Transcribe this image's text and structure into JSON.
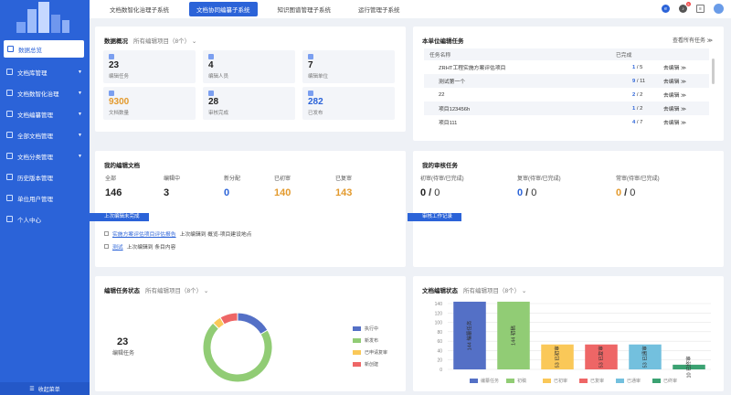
{
  "sidebar": {
    "collapse_label": "收起菜单",
    "items": [
      {
        "label": "数据总览",
        "active": true
      },
      {
        "label": "文档库管理",
        "arrow": true
      },
      {
        "label": "文档数智化治理",
        "arrow": true
      },
      {
        "label": "文档编纂管理",
        "arrow": true
      },
      {
        "label": "全部文档管理",
        "arrow": true
      },
      {
        "label": "文档分类管理",
        "arrow": true
      },
      {
        "label": "历史版本管理"
      },
      {
        "label": "单位用户管理"
      },
      {
        "label": "个人中心"
      }
    ]
  },
  "topbar": {
    "tabs": [
      "文档数智化治理子系统",
      "文档协同编纂子系统",
      "知识图谱管理子系统",
      "运行管理子系统"
    ],
    "active_tab": 1,
    "notification_count": "5"
  },
  "overview": {
    "title": "数据概况",
    "filter": "所有编辑项目（8个）",
    "stats": [
      {
        "value": "23",
        "label": "编辑任务",
        "color": "#222"
      },
      {
        "value": "4",
        "label": "编辑人员",
        "color": "#222"
      },
      {
        "value": "7",
        "label": "编辑单位",
        "color": "#222"
      },
      {
        "value": "9300",
        "label": "文档数量",
        "color": "#e39a2d"
      },
      {
        "value": "28",
        "label": "审核完成",
        "color": "#222"
      },
      {
        "value": "282",
        "label": "已发布",
        "color": "#2b63d8"
      }
    ]
  },
  "tasks": {
    "title": "本单位编辑任务",
    "view_all": "查看所有任务 ≫",
    "headers": [
      "任务名称",
      "已完成",
      ""
    ],
    "rows": [
      {
        "name": "ZRHT工程实施方案评估项目",
        "done": "1",
        "total": "5",
        "action": "去编辑 ≫"
      },
      {
        "name": "测试第一个",
        "done": "9",
        "total": "11",
        "action": "去编辑 ≫"
      },
      {
        "name": "22",
        "done": "2",
        "total": "2",
        "action": "去编辑 ≫"
      },
      {
        "name": "项目123456h",
        "done": "1",
        "total": "2",
        "action": "去编辑 ≫"
      },
      {
        "name": "项目111",
        "done": "4",
        "total": "7",
        "action": "去编辑 ≫"
      }
    ]
  },
  "mydocs": {
    "title": "我的编辑文档",
    "summary": [
      {
        "label": "全部",
        "value": "146",
        "color": "#222"
      },
      {
        "label": "编辑中",
        "value": "3",
        "color": "#222"
      },
      {
        "label": "新分配",
        "value": "0",
        "color": "#2b63d8"
      },
      {
        "label": "已初审",
        "value": "140",
        "color": "#e39a2d"
      },
      {
        "label": "已复审",
        "value": "143",
        "color": "#e39a2d"
      }
    ],
    "flag": "上次编辑未完成",
    "docs": [
      {
        "name": "实施方案评估项目评估报告",
        "text": "上次编辑到 概览-项目建设地点"
      },
      {
        "name": "测试",
        "text": "上次编辑到 条目内容"
      }
    ]
  },
  "myreview": {
    "title": "我的审核任务",
    "cols": [
      {
        "label": "初审(待审/已完成)",
        "pending": "0",
        "done": "0",
        "color": "#222"
      },
      {
        "label": "复审(待审/已完成)",
        "pending": "0",
        "done": "0",
        "color": "#2b63d8"
      },
      {
        "label": "常审(待审/已完成)",
        "pending": "0",
        "done": "0",
        "color": "#e39a2d"
      }
    ],
    "flag": "审核工作记录"
  },
  "taskstatus": {
    "title": "编辑任务状态",
    "filter": "所有编辑项目（8个）",
    "total": "23",
    "total_label": "编辑任务",
    "chart_data": {
      "type": "pie",
      "series": [
        {
          "name": "执行中",
          "value": 4,
          "color": "#5470c6"
        },
        {
          "name": "新发布",
          "value": 17,
          "color": "#91cc75"
        },
        {
          "name": "已申请复审",
          "value": 1,
          "color": "#fac858"
        },
        {
          "name": "新创建",
          "value": 2,
          "color": "#ee6666"
        }
      ]
    }
  },
  "docstatus": {
    "title": "文档编辑状态",
    "filter": "所有编辑项目（8个）",
    "chart_data": {
      "type": "bar",
      "categories": [
        "编纂任务",
        "初稿",
        "已初审",
        "已复审",
        "已通审",
        "已终审"
      ],
      "values": [
        144,
        144,
        53,
        53,
        53,
        10
      ],
      "bar_labels": [
        "144 编纂任务",
        "144 初稿",
        "53 已初审",
        "53 已复审",
        "53 已通审",
        "10 已终审"
      ],
      "colors": [
        "#5470c6",
        "#91cc75",
        "#fac858",
        "#ee6666",
        "#73c0de",
        "#3ba272"
      ],
      "yticks": [
        "0",
        "20",
        "40",
        "60",
        "80",
        "100",
        "120",
        "140"
      ],
      "ylim": [
        0,
        140
      ]
    }
  }
}
